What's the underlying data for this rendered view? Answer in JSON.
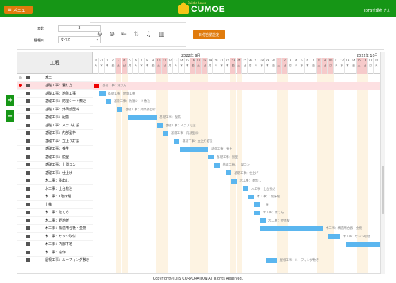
{
  "header": {
    "menu_label": "メニュー",
    "logo_text": "CUMOE",
    "logo_sub": "Build a house",
    "user": "IDTS管理者 さん"
  },
  "panel": {
    "count_label": "表数",
    "count_value": "3",
    "category_label": "工種種目",
    "category_value": "すべて",
    "set_button": "日付自動設定"
  },
  "grid": {
    "header": "工程",
    "month1": "2022年 9月",
    "month2": "2022年 10月"
  },
  "days": [
    "30",
    "31",
    "1",
    "2",
    "3",
    "4",
    "5",
    "6",
    "7",
    "8",
    "9",
    "10",
    "11",
    "12",
    "13",
    "14",
    "15",
    "16",
    "17",
    "18",
    "19",
    "20",
    "21",
    "22",
    "23",
    "24",
    "25",
    "26",
    "27",
    "28",
    "29",
    "30",
    "1",
    "2",
    "3",
    "4",
    "5",
    "6",
    "7",
    "8",
    "9",
    "10",
    "11",
    "12",
    "13",
    "14",
    "15",
    "16",
    "17",
    "18"
  ],
  "weekdays": [
    "火",
    "水",
    "木",
    "金",
    "土",
    "日",
    "月",
    "火",
    "水",
    "木",
    "金",
    "土",
    "日",
    "月",
    "火",
    "水",
    "木",
    "金",
    "土",
    "日",
    "月",
    "火",
    "水",
    "木",
    "金",
    "土",
    "日",
    "月",
    "火",
    "水",
    "木",
    "金",
    "土",
    "日",
    "月",
    "火",
    "水",
    "木",
    "金",
    "土",
    "日",
    "月",
    "火",
    "水",
    "木",
    "金",
    "土",
    "日",
    "月",
    "火"
  ],
  "weekend_idx": [
    4,
    5,
    11,
    12,
    17,
    18,
    19,
    24,
    25,
    32,
    33,
    39,
    40,
    41,
    46,
    47
  ],
  "rows": [
    {
      "name": "着工",
      "start": -1,
      "len": 0
    },
    {
      "name": "基礎工事：遣り方",
      "start": 0,
      "len": 1,
      "red": true
    },
    {
      "name": "基礎工事：地盤工事",
      "start": 1,
      "len": 1
    },
    {
      "name": "基礎工事：防湿シート敷込",
      "start": 2,
      "len": 1
    },
    {
      "name": "基礎工事：外周部型枠",
      "start": 4,
      "len": 1
    },
    {
      "name": "基礎工事：配筋",
      "start": 6,
      "len": 5
    },
    {
      "name": "基礎工事：スラブ打設",
      "start": 11,
      "len": 1
    },
    {
      "name": "基礎工事：内部型枠",
      "start": 12,
      "len": 1
    },
    {
      "name": "基礎工事：立上り打設",
      "start": 14,
      "len": 1
    },
    {
      "name": "基礎工事：養生",
      "start": 15,
      "len": 5
    },
    {
      "name": "基礎工事：脱型",
      "start": 20,
      "len": 1
    },
    {
      "name": "基礎工事：土間コン",
      "start": 21,
      "len": 1
    },
    {
      "name": "基礎工事：仕上げ",
      "start": 23,
      "len": 1
    },
    {
      "name": "木工事：墨出し",
      "start": 24,
      "len": 1
    },
    {
      "name": "木工事：土台敷込",
      "start": 26,
      "len": 1
    },
    {
      "name": "木工事：1階床組",
      "start": 27,
      "len": 1
    },
    {
      "name": "上棟",
      "start": 28,
      "len": 1
    },
    {
      "name": "木工事：建て方",
      "start": 28,
      "len": 1
    },
    {
      "name": "木工事：野地板",
      "start": 29,
      "len": 1
    },
    {
      "name": "木工事：構造用合板・金物",
      "start": 29,
      "len": 11
    },
    {
      "name": "木工事：サッシ取付",
      "start": 41,
      "len": 2
    },
    {
      "name": "木工事：内部下地",
      "start": 44,
      "len": 10
    },
    {
      "name": "木工事：造作",
      "start": -1,
      "len": 0
    },
    {
      "name": "屋根工事：ルーフィング敷き",
      "start": 30,
      "len": 2
    }
  ],
  "bar_labels": [
    "",
    "基礎工事：遣り方",
    "基礎工事：地盤工事",
    "基礎工事：防湿シート敷込",
    "基礎工事：外周部型枠",
    "基礎工事：配筋",
    "基礎工事：スラブ打設",
    "基礎工事：内部型枠",
    "基礎工事：立上り打設",
    "基礎工事：養生",
    "基礎工事：脱型",
    "基礎工事：土間コン",
    "基礎工事：仕上げ",
    "木工事：墨出し",
    "木工事：土台敷込",
    "木工事：1階床組",
    "上棟",
    "木工事：建て方",
    "木工事：野地板",
    "木工事：構造用合板・金物",
    "木工事：サッシ取付",
    "",
    "",
    "屋根工事：ルーフィング敷き"
  ],
  "footer": "Copyright©IDTS CORPORATION All Rights Reserved.",
  "colors": {
    "green": "#169616",
    "orange": "#e07b0c",
    "bar": "#5bb6ef"
  }
}
